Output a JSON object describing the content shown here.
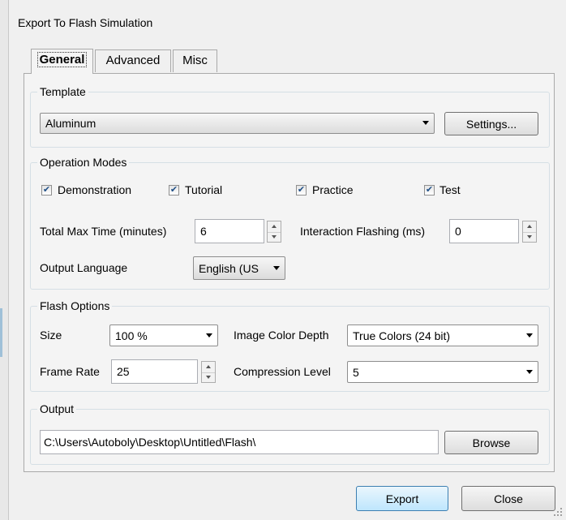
{
  "window": {
    "title": "Export To Flash Simulation"
  },
  "tabs": [
    {
      "label": "General",
      "active": true
    },
    {
      "label": "Advanced",
      "active": false
    },
    {
      "label": "Misc",
      "active": false
    }
  ],
  "template": {
    "group_label": "Template",
    "selected": "Aluminum",
    "settings_label": "Settings..."
  },
  "operation_modes": {
    "group_label": "Operation Modes",
    "checkboxes": [
      {
        "label": "Demonstration",
        "checked": true
      },
      {
        "label": "Tutorial",
        "checked": true
      },
      {
        "label": "Practice",
        "checked": true
      },
      {
        "label": "Test",
        "checked": true
      }
    ],
    "total_max_time_label": "Total Max Time (minutes)",
    "total_max_time_value": "6",
    "interaction_flashing_label": "Interaction Flashing (ms)",
    "interaction_flashing_value": "0",
    "output_language_label": "Output Language",
    "output_language_value": "English (US"
  },
  "flash_options": {
    "group_label": "Flash Options",
    "size_label": "Size",
    "size_value": "100 %",
    "image_color_depth_label": "Image Color Depth",
    "image_color_depth_value": "True Colors (24 bit)",
    "frame_rate_label": "Frame Rate",
    "frame_rate_value": "25",
    "compression_level_label": "Compression Level",
    "compression_level_value": "5"
  },
  "output": {
    "group_label": "Output",
    "path": "C:\\Users\\Autoboly\\Desktop\\Untitled\\Flash\\",
    "browse_label": "Browse"
  },
  "footer": {
    "export_label": "Export",
    "close_label": "Close"
  },
  "colors": {
    "window_bg": "#f0f0f0",
    "default_button_border": "#3c7fb1",
    "checkmark": "#1f4f86"
  }
}
